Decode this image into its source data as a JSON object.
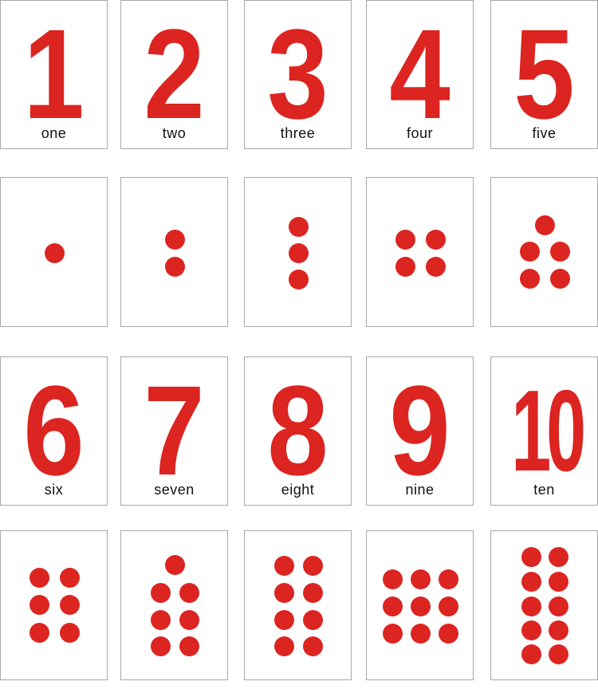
{
  "accent_color": "#dc2420",
  "numeral_cards": [
    {
      "numeral": "1",
      "word": "one"
    },
    {
      "numeral": "2",
      "word": "two"
    },
    {
      "numeral": "3",
      "word": "three"
    },
    {
      "numeral": "4",
      "word": "four"
    },
    {
      "numeral": "5",
      "word": "five"
    },
    {
      "numeral": "6",
      "word": "six"
    },
    {
      "numeral": "7",
      "word": "seven"
    },
    {
      "numeral": "8",
      "word": "eight"
    },
    {
      "numeral": "9",
      "word": "nine"
    },
    {
      "numeral": "10",
      "word": "ten"
    }
  ],
  "dot_cards": [
    {
      "dots": 1
    },
    {
      "dots": 2
    },
    {
      "dots": 3
    },
    {
      "dots": 4
    },
    {
      "dots": 5
    },
    {
      "dots": 6
    },
    {
      "dots": 7
    },
    {
      "dots": 8
    },
    {
      "dots": 9
    },
    {
      "dots": 10
    }
  ]
}
